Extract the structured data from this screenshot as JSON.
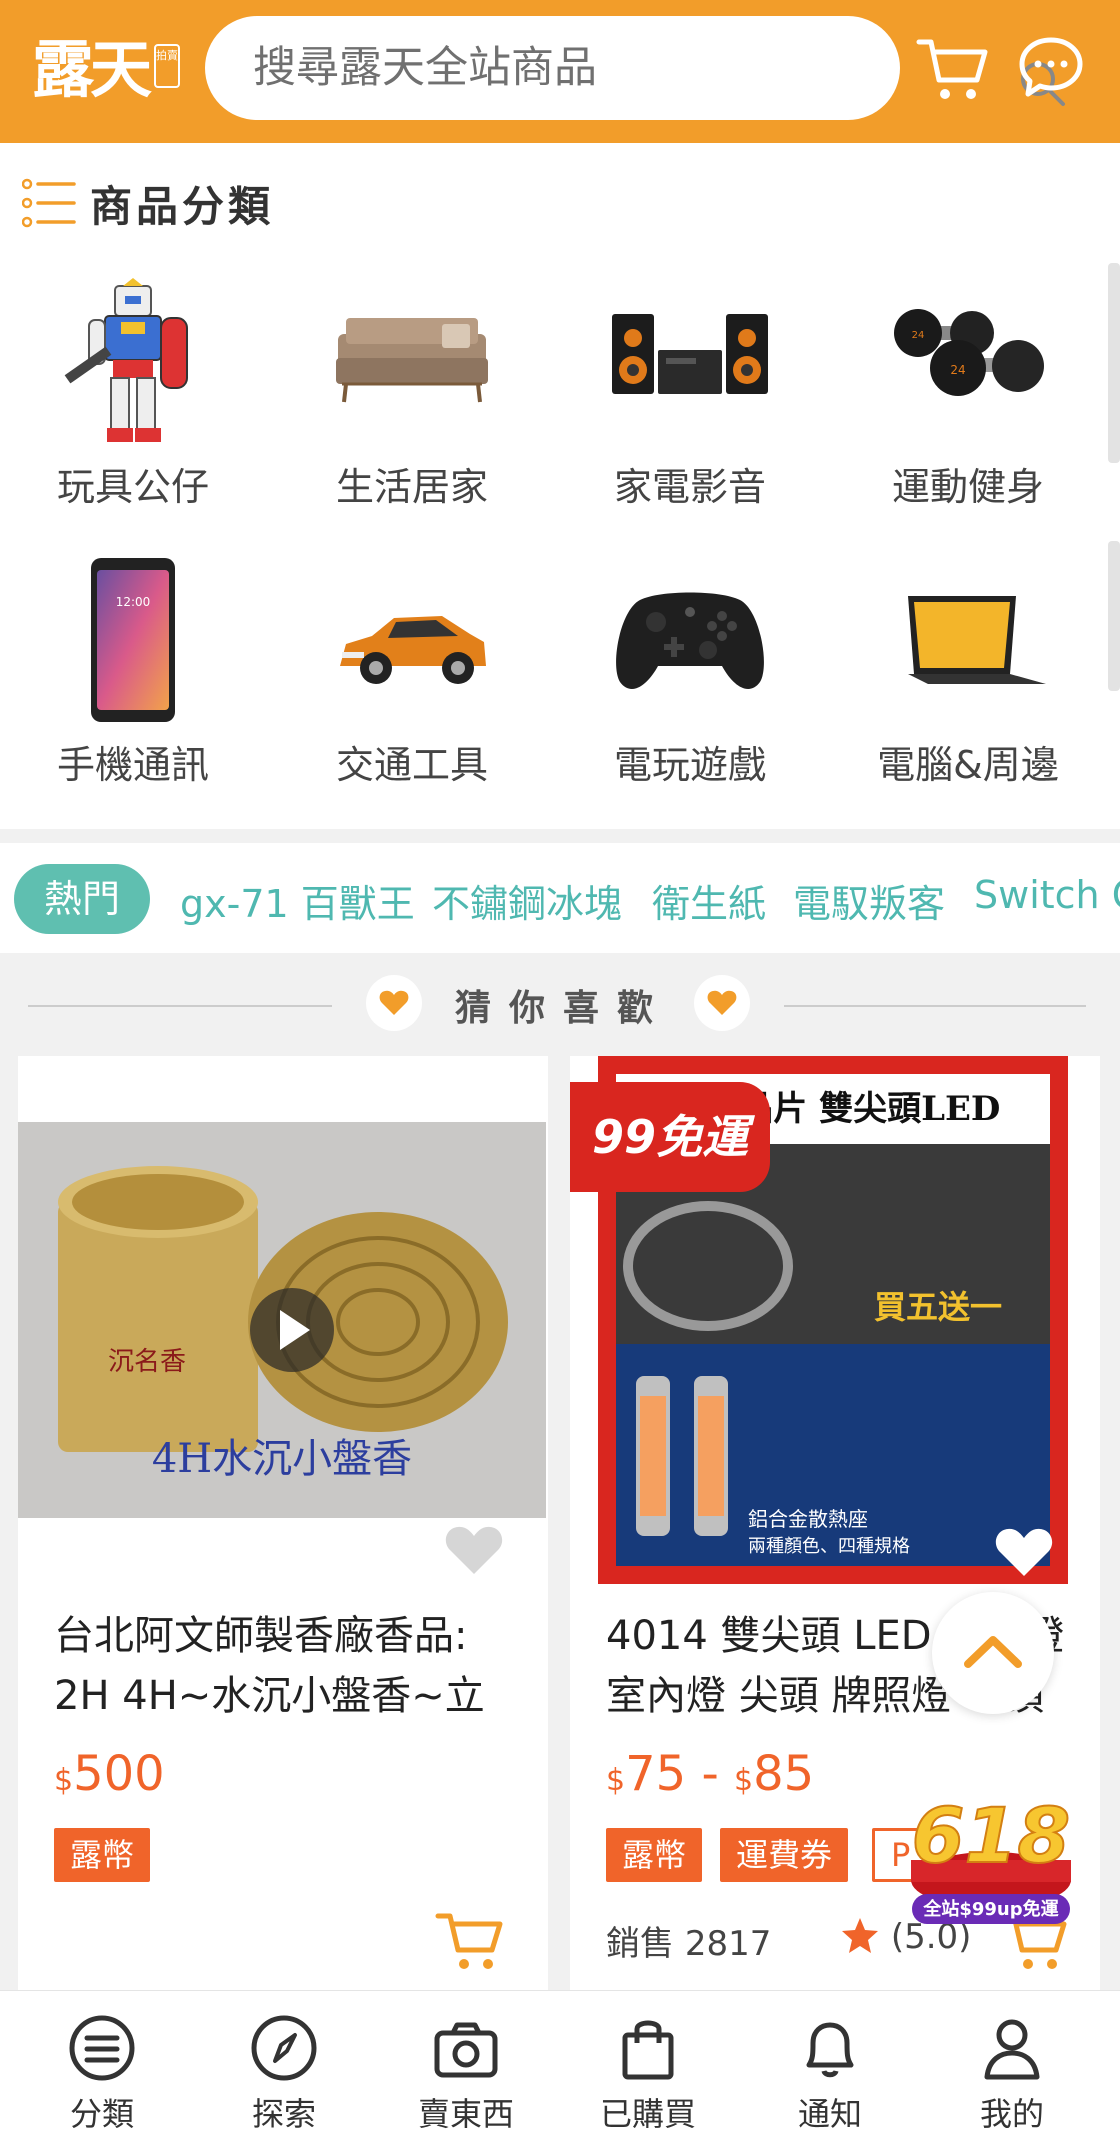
{
  "header": {
    "logo_text": "露天",
    "logo_tag": "拍賣",
    "search_placeholder": "搜尋露天全站商品",
    "brand_color": "#f29d2a"
  },
  "categories": {
    "title": "商品分類",
    "items": [
      {
        "label": "玩具公仔",
        "icon": "robot-figure"
      },
      {
        "label": "生活居家",
        "icon": "sofa"
      },
      {
        "label": "家電影音",
        "icon": "speaker-system"
      },
      {
        "label": "運動健身",
        "icon": "dumbbells"
      },
      {
        "label": "手機通訊",
        "icon": "smartphone"
      },
      {
        "label": "交通工具",
        "icon": "car"
      },
      {
        "label": "電玩遊戲",
        "icon": "game-controller"
      },
      {
        "label": "電腦&周邊",
        "icon": "laptop"
      }
    ]
  },
  "hot": {
    "badge": "熱門",
    "tags": [
      "gx-71 百獸王",
      "不鏽鋼冰塊",
      "衛生紙",
      "電馭叛客",
      "Switch O"
    ]
  },
  "guess": {
    "title": "猜你喜歡"
  },
  "products": [
    {
      "title": "台北阿文師製香廠香品: 2H 4H~水沉小盤香~立",
      "image_caption": "4H水沉小盤香",
      "image_label": "沉名香",
      "currency": "$",
      "price": "500",
      "tags": [
        "露幣"
      ]
    },
    {
      "title": "4014 雙尖頭 LED 閱讀燈 室內燈 尖頭 牌照燈 車頂",
      "image_banner": "4晶片 雙尖頭LED",
      "image_promo": "買五送一",
      "image_caption": "鋁合金散熱座",
      "image_subcaption": "兩種顏色、四種規格",
      "shipping_badge": "99免運",
      "currency": "$",
      "price_low": "75",
      "price_sep": "-",
      "price_high": "85",
      "tags": [
        "露幣",
        "運費券",
        "P"
      ],
      "sales_label": "銷售",
      "sales_count": "2817",
      "rating": "(5.0)"
    }
  ],
  "promo": {
    "number": "618",
    "caption": "全站$99up免運"
  },
  "bottom_nav": [
    {
      "label": "分類",
      "icon": "list-icon"
    },
    {
      "label": "探索",
      "icon": "compass-icon"
    },
    {
      "label": "賣東西",
      "icon": "camera-icon"
    },
    {
      "label": "已購買",
      "icon": "shopping-bag-icon"
    },
    {
      "label": "通知",
      "icon": "bell-icon"
    },
    {
      "label": "我的",
      "icon": "user-icon"
    }
  ],
  "colors": {
    "accent": "#f0642a",
    "hot_teal": "#5fbfb0"
  }
}
